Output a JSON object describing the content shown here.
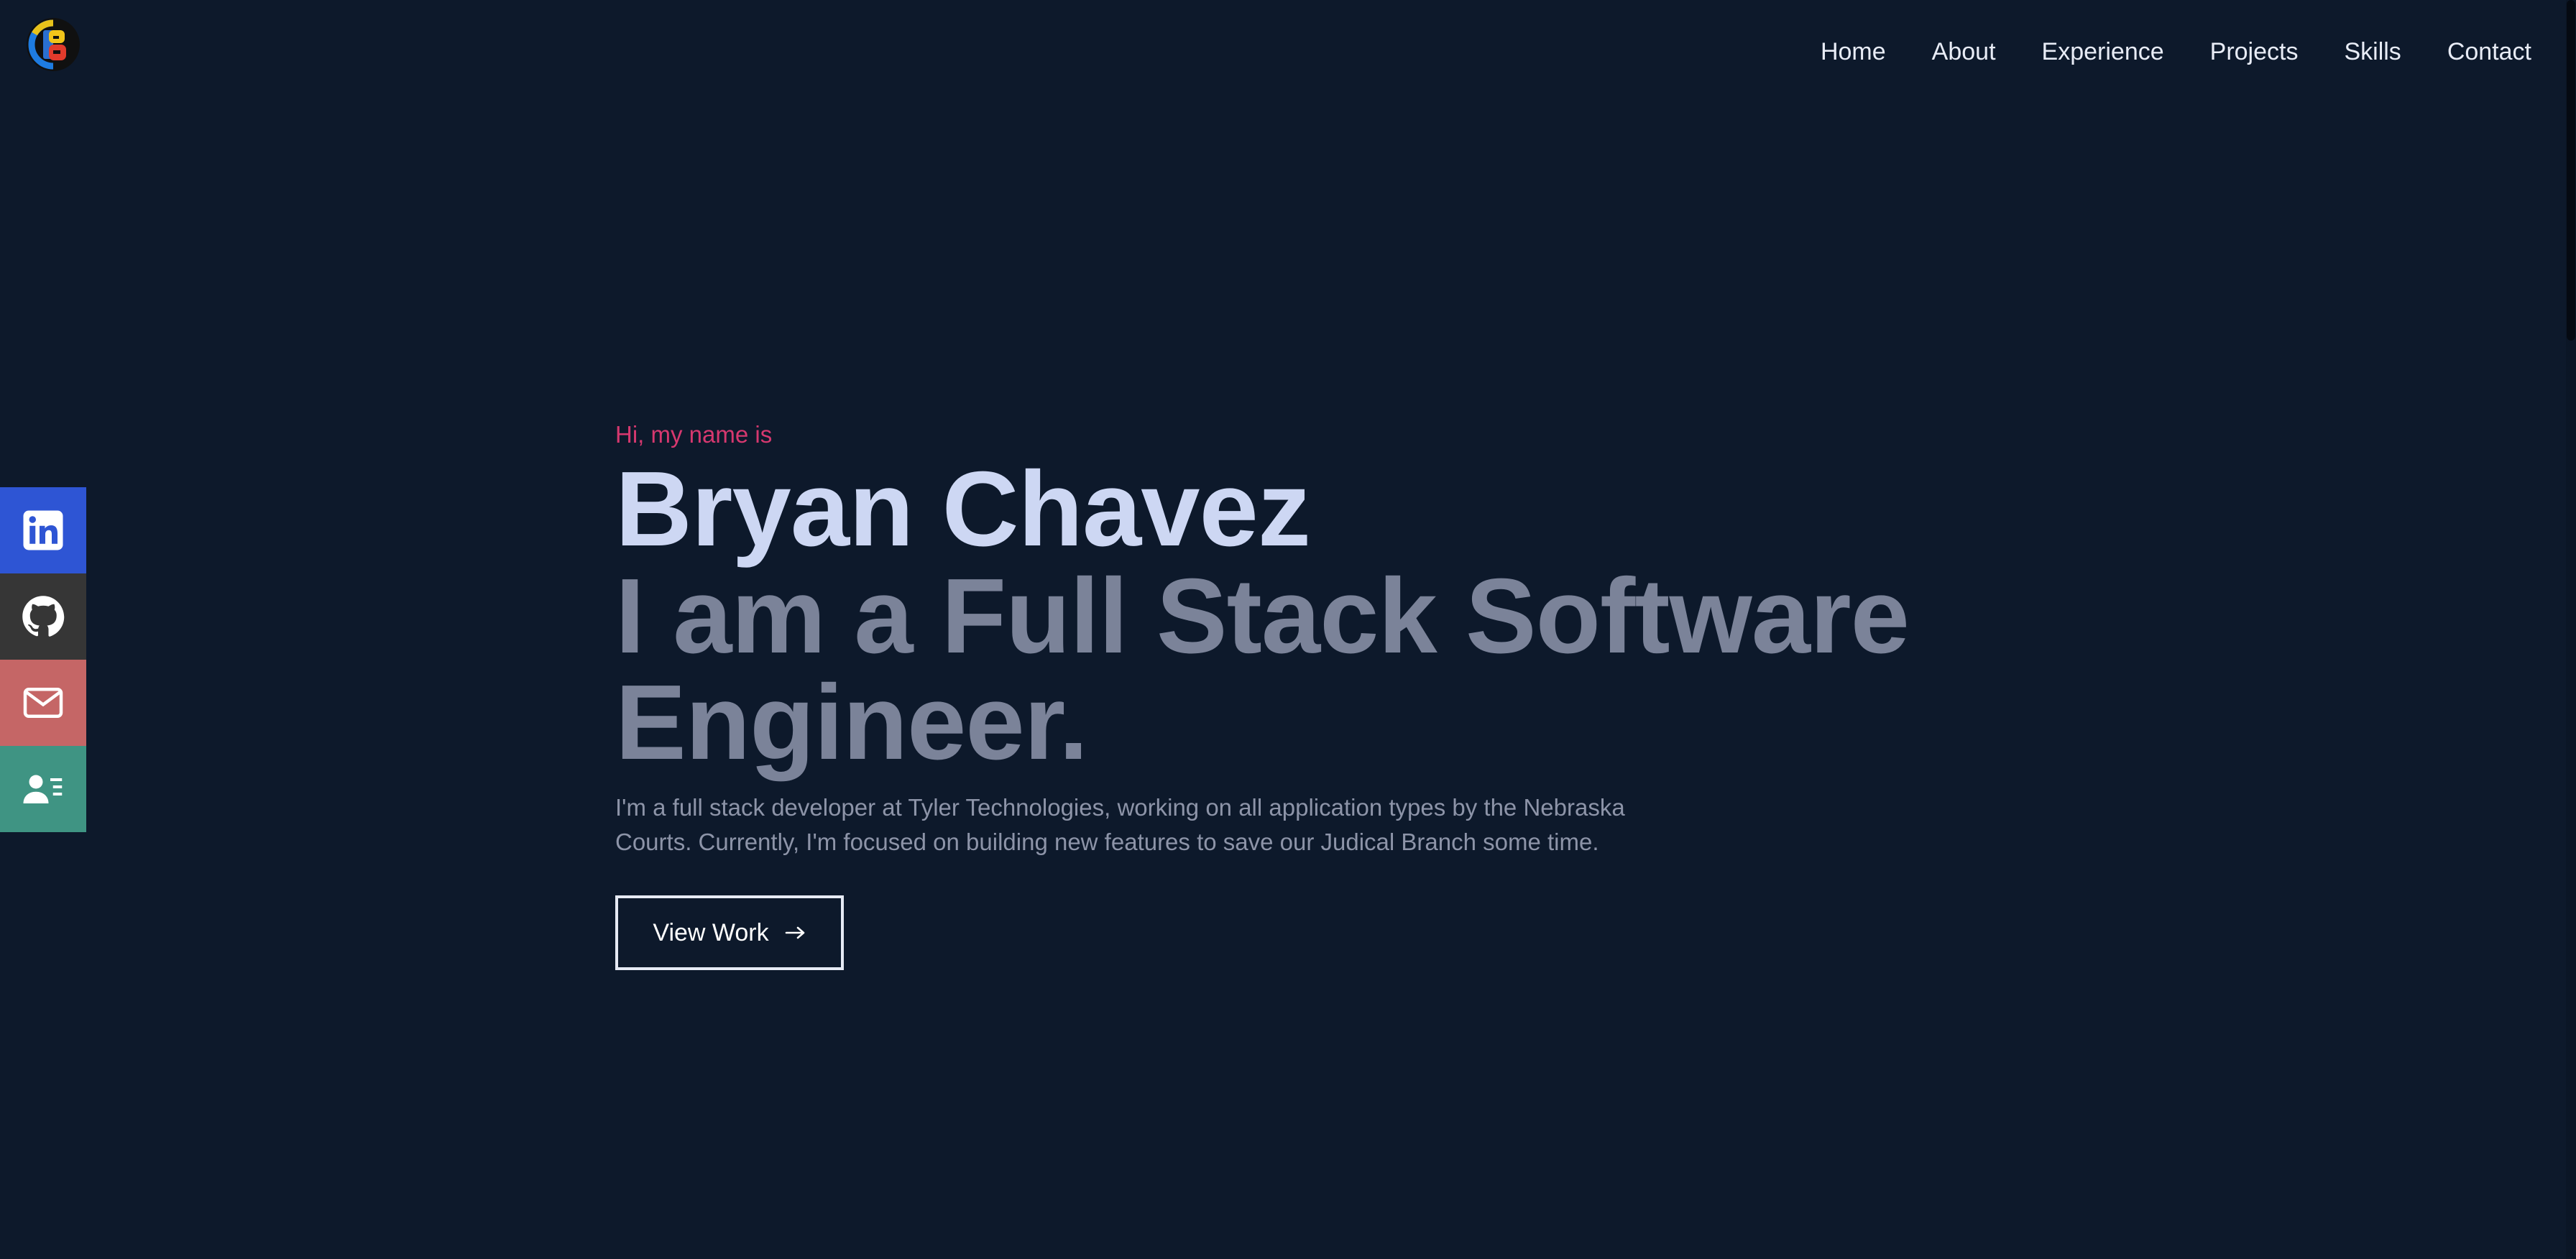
{
  "nav": {
    "items": [
      {
        "label": "Home"
      },
      {
        "label": "About"
      },
      {
        "label": "Experience"
      },
      {
        "label": "Projects"
      },
      {
        "label": "Skills"
      },
      {
        "label": "Contact"
      }
    ]
  },
  "social": [
    {
      "icon": "linkedin-icon",
      "color": "#2e55d4"
    },
    {
      "icon": "github-icon",
      "color": "#363636"
    },
    {
      "icon": "mail-icon",
      "color": "#c56666"
    },
    {
      "icon": "resume-icon",
      "color": "#3f9483"
    }
  ],
  "hero": {
    "greeting": "Hi, my name is",
    "name": "Bryan Chavez",
    "tagline": "I am a Full Stack Software Engineer.",
    "description": "I'm a full stack developer at Tyler Technologies, working on all application types by the Nebraska Courts. Currently, I'm focused on building new features to save our Judical Branch some time.",
    "cta_label": "View Work"
  },
  "colors": {
    "background": "#0d192b",
    "accent": "#d6386f",
    "name": "#cdd7f3",
    "tagline": "#7b8399"
  }
}
